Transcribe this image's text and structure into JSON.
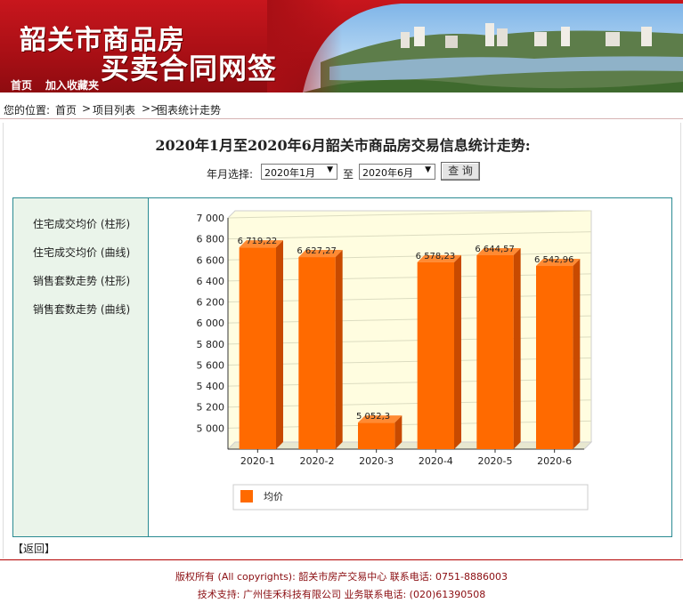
{
  "header": {
    "logo_line1": "韶关市商品房",
    "logo_line2": "买卖合同网签",
    "nav": [
      "首页",
      "加入收藏夹"
    ]
  },
  "breadcrumb": {
    "prefix": "您的位置:",
    "items": [
      "首页",
      "项目列表",
      "图表统计走势"
    ],
    "separators": [
      ">",
      ">>"
    ]
  },
  "page_title": "2020年1月至2020年6月韶关市商品房交易信息统计走势:",
  "filters": {
    "label": "年月选择:",
    "start_value": "2020年1月",
    "to_label": "至",
    "end_value": "2020年6月",
    "query_button": "查 询"
  },
  "sidebar": {
    "items": [
      "住宅成交均价 (柱形)",
      "住宅成交均价 (曲线)",
      "销售套数走势 (柱形)",
      "销售套数走势 (曲线)"
    ]
  },
  "chart_data": {
    "type": "bar",
    "categories": [
      "2020-1",
      "2020-2",
      "2020-3",
      "2020-4",
      "2020-5",
      "2020-6"
    ],
    "series": [
      {
        "name": "均价",
        "values": [
          6719.22,
          6627.27,
          5052.3,
          6578.23,
          6644.57,
          6542.96
        ]
      }
    ],
    "data_labels": [
      "6 719,22",
      "6 627,27",
      "5 052,3",
      "6 578,23",
      "6 644,57",
      "6 542,96"
    ],
    "y_ticks": [
      "7 000",
      "6 800",
      "6 600",
      "6 400",
      "6 200",
      "6 000",
      "5 800",
      "5 600",
      "5 400",
      "5 200",
      "5 000"
    ],
    "ylim": [
      4800,
      7000
    ],
    "grid": true,
    "legend_placement": "bottom",
    "colors": {
      "bar": "#ff6a00",
      "bar_side": "#c84a00",
      "bar_top": "#ff8a33",
      "plot_bg": "#fffde0"
    }
  },
  "back_link": "【返回】",
  "footer": {
    "line1": "版权所有 (All copyrights): 韶关市房产交易中心  联系电话: 0751-8886003",
    "line2": "技术支持: 广州佳禾科技有限公司       业务联系电话: (020)61390508"
  }
}
